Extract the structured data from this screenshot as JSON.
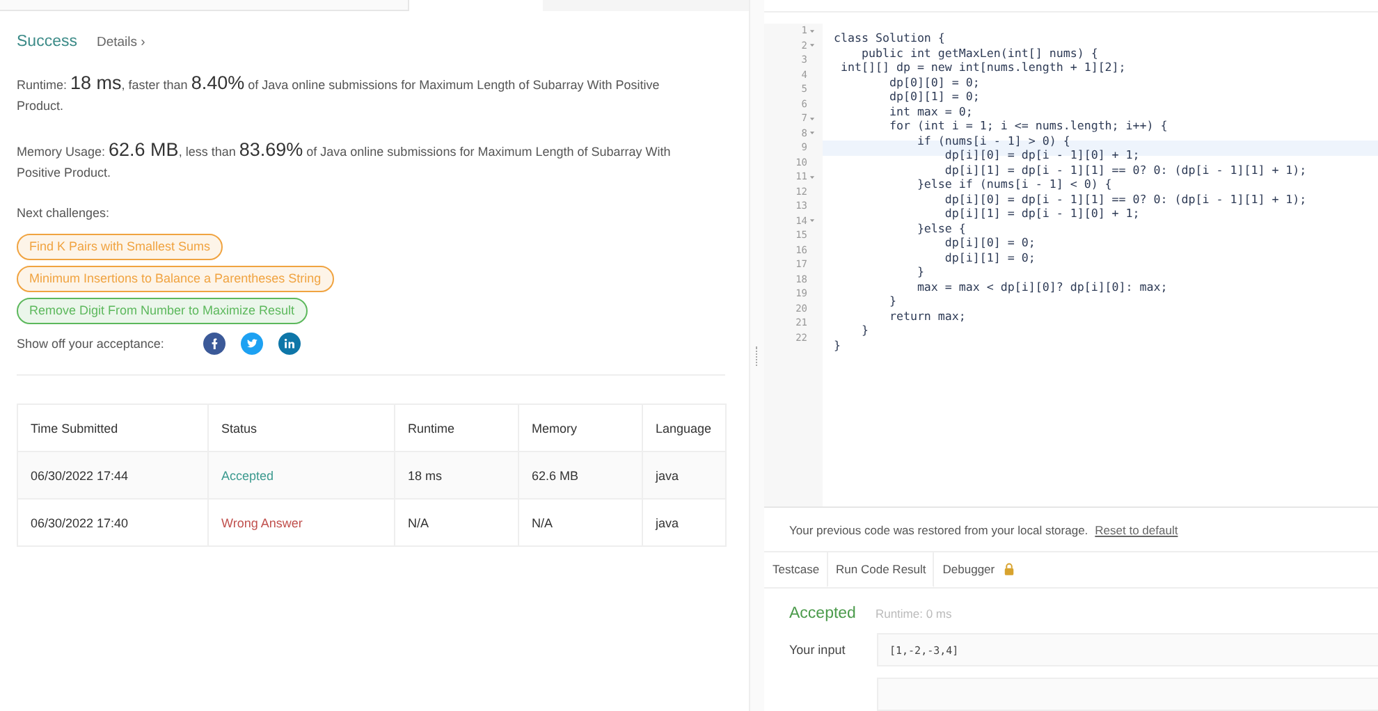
{
  "submission": {
    "status": "Success",
    "details_link": "Details ›",
    "runtime": [
      {
        "kind": "plain",
        "text": "Runtime: "
      },
      {
        "kind": "big",
        "text": "18 ms"
      },
      {
        "kind": "plain",
        "text": ", faster than "
      },
      {
        "kind": "big",
        "text": "8.40%"
      },
      {
        "kind": "plain",
        "text": " of Java online submissions for Maximum Length of Subarray With Positive Product."
      }
    ],
    "memory": [
      {
        "kind": "plain",
        "text": "Memory Usage: "
      },
      {
        "kind": "big",
        "text": "62.6 MB"
      },
      {
        "kind": "plain",
        "text": ", less than "
      },
      {
        "kind": "big",
        "text": "83.69%"
      },
      {
        "kind": "plain",
        "text": " of Java online submissions for Maximum Length of Subarray With Positive Product."
      }
    ],
    "challenges_label": "Next challenges:",
    "challenges": [
      {
        "text": "Find K Pairs with Smallest Sums",
        "color": "#f0a340"
      },
      {
        "text": "Minimum Insertions to Balance a Parentheses String",
        "color": "#f0a340"
      },
      {
        "text": "Remove Digit From Number to Maximize Result",
        "color": "#5cb85c"
      }
    ],
    "share_label": "Show off your acceptance:",
    "share": [
      {
        "kind": "facebook"
      },
      {
        "kind": "twitter"
      },
      {
        "kind": "linkedin"
      }
    ]
  },
  "table": {
    "columns": [
      "Time Submitted",
      "Status",
      "Runtime",
      "Memory",
      "Language"
    ],
    "rows": [
      {
        "time": "06/30/2022 17:44",
        "status": "Accepted",
        "color": "#3c9a8f",
        "runtime": "18 ms",
        "memory": "62.6 MB",
        "language": "java"
      },
      {
        "time": "06/30/2022 17:40",
        "status": "Wrong Answer",
        "color": "#c0504d",
        "runtime": "N/A",
        "memory": "N/A",
        "language": "java"
      }
    ]
  },
  "editor": {
    "lines": [
      {
        "number": "1",
        "fold": true,
        "highlighted": false,
        "code": "class Solution {"
      },
      {
        "number": "2",
        "fold": true,
        "highlighted": false,
        "code": "    public int getMaxLen(int[] nums) {"
      },
      {
        "number": "3",
        "fold": false,
        "highlighted": false,
        "code": " int[][] dp = new int[nums.length + 1][2];"
      },
      {
        "number": "4",
        "fold": false,
        "highlighted": false,
        "code": "        dp[0][0] = 0;"
      },
      {
        "number": "5",
        "fold": false,
        "highlighted": false,
        "code": "        dp[0][1] = 0;"
      },
      {
        "number": "6",
        "fold": false,
        "highlighted": false,
        "code": "        int max = 0;"
      },
      {
        "number": "7",
        "fold": true,
        "highlighted": false,
        "code": "        for (int i = 1; i <= nums.length; i++) {"
      },
      {
        "number": "8",
        "fold": true,
        "highlighted": false,
        "code": "            if (nums[i - 1] > 0) {"
      },
      {
        "number": "9",
        "fold": false,
        "highlighted": true,
        "code": "                dp[i][0] = dp[i - 1][0] + 1;"
      },
      {
        "number": "10",
        "fold": false,
        "highlighted": false,
        "code": "                dp[i][1] = dp[i - 1][1] == 0? 0: (dp[i - 1][1] + 1);"
      },
      {
        "number": "11",
        "fold": true,
        "highlighted": false,
        "code": "            }else if (nums[i - 1] < 0) {"
      },
      {
        "number": "12",
        "fold": false,
        "highlighted": false,
        "code": "                dp[i][0] = dp[i - 1][1] == 0? 0: (dp[i - 1][1] + 1);"
      },
      {
        "number": "13",
        "fold": false,
        "highlighted": false,
        "code": "                dp[i][1] = dp[i - 1][0] + 1;"
      },
      {
        "number": "14",
        "fold": true,
        "highlighted": false,
        "code": "            }else {"
      },
      {
        "number": "15",
        "fold": false,
        "highlighted": false,
        "code": "                dp[i][0] = 0;"
      },
      {
        "number": "16",
        "fold": false,
        "highlighted": false,
        "code": "                dp[i][1] = 0;"
      },
      {
        "number": "17",
        "fold": false,
        "highlighted": false,
        "code": "            }"
      },
      {
        "number": "18",
        "fold": false,
        "highlighted": false,
        "code": "            max = max < dp[i][0]? dp[i][0]: max;"
      },
      {
        "number": "19",
        "fold": false,
        "highlighted": false,
        "code": "        }"
      },
      {
        "number": "20",
        "fold": false,
        "highlighted": false,
        "code": "        return max;"
      },
      {
        "number": "21",
        "fold": false,
        "highlighted": false,
        "code": "    }"
      },
      {
        "number": "22",
        "fold": false,
        "highlighted": false,
        "code": "}"
      }
    ]
  },
  "notice": {
    "text": "Your previous code was restored from your local storage.",
    "link": "Reset to default"
  },
  "console_tabs": [
    {
      "label": "Testcase",
      "selected": false,
      "locked": false
    },
    {
      "label": "Run Code Result",
      "selected": true,
      "locked": false
    },
    {
      "label": "Debugger",
      "selected": false,
      "locked": true
    }
  ],
  "result": {
    "status": "Accepted",
    "runtime": "Runtime: 0 ms",
    "input_label": "Your input",
    "input_value": "[1,-2,-3,4]"
  }
}
